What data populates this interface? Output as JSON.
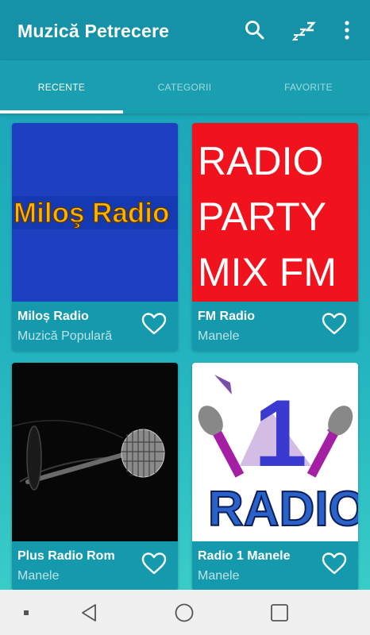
{
  "app": {
    "title": "Muzică Petrecere"
  },
  "toolbar": {
    "actions": [
      "search-icon",
      "sleep-timer-icon",
      "more-vert-icon"
    ]
  },
  "tabs": [
    {
      "label": "RECENTE",
      "active": true
    },
    {
      "label": "CATEGORII",
      "active": false
    },
    {
      "label": "FAVORITE",
      "active": false
    }
  ],
  "stations": [
    {
      "name": "Miloș Radio",
      "genre": "Muzică Populară",
      "logo_text": "Miloş Radio"
    },
    {
      "name": "FM Radio",
      "genre": "Manele",
      "logo_lines": [
        "RADIO",
        "PARTY",
        "MIX FM"
      ]
    },
    {
      "name": "Plus Radio Rom",
      "genre": "Manele"
    },
    {
      "name": "Radio 1 Manele",
      "genre": "Manele",
      "logo_digit": "1",
      "logo_text": "RADIO"
    }
  ],
  "colors": {
    "accent": "#1592a8",
    "tab_bar": "#1a9fb0",
    "card": "#159aad"
  }
}
